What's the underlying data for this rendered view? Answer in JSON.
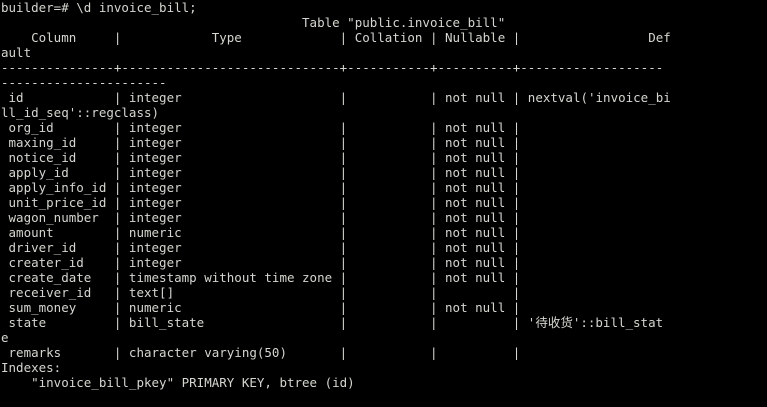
{
  "terminal": {
    "prompt": "builder=#",
    "command": "\\d invoice_bill;",
    "colors": {
      "background": "#000000",
      "foreground": "#d3d7cf"
    }
  },
  "table": {
    "title_line": "                                        Table \"public.invoice_bill\"",
    "header_line": "    Column     |            Type             | Collation | Nullable |                 Def",
    "header_wrap": "ault",
    "separator_line": "---------------+-----------------------------+-----------+----------+-------------------",
    "separator_wrap": "----------------------",
    "rows": [
      " id            | integer                     |           | not null | nextval('invoice_bi",
      "ll_id_seq'::regclass)",
      " org_id        | integer                     |           | not null |",
      " maxing_id     | integer                     |           | not null |",
      " notice_id     | integer                     |           | not null |",
      " apply_id      | integer                     |           | not null |",
      " apply_info_id | integer                     |           | not null |",
      " unit_price_id | integer                     |           | not null |",
      " wagon_number  | integer                     |           | not null |",
      " amount        | numeric                     |           | not null |",
      " driver_id     | integer                     |           | not null |",
      " creater_id    | integer                     |           | not null |",
      " create_date   | timestamp without time zone |           | not null |",
      " receiver_id   | text[]                      |           |          |",
      " sum_money     | numeric                     |           | not null |",
      " state         | bill_state                  |           |          | '待收货'::bill_stat",
      "e",
      " remarks       | character varying(50)       |           |          |"
    ]
  },
  "indexes": {
    "label": "Indexes:",
    "entries": [
      "    \"invoice_bill_pkey\" PRIMARY KEY, btree (id)"
    ]
  }
}
